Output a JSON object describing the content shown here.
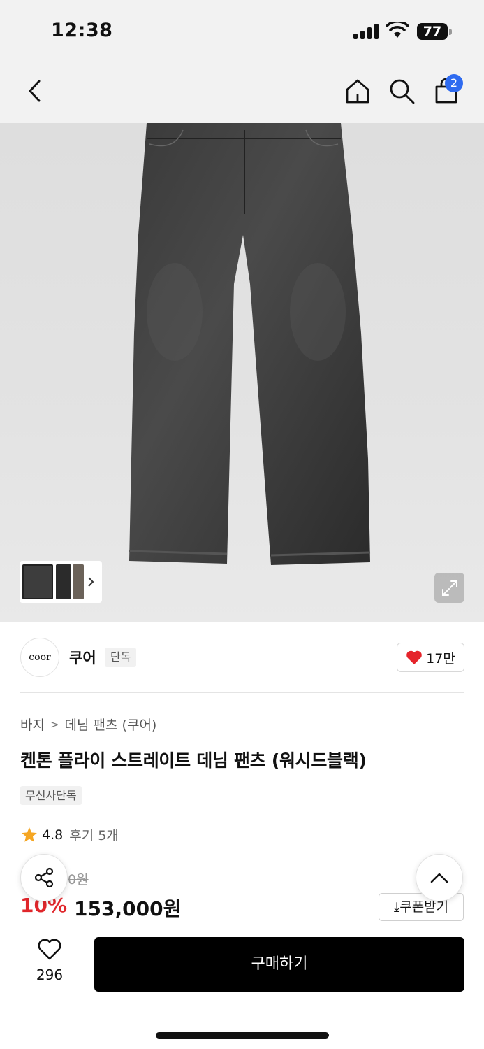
{
  "status": {
    "time": "12:38",
    "battery": "77"
  },
  "nav": {
    "cart_count": "2"
  },
  "brand": {
    "logo_text": "coor",
    "name": "쿠어",
    "tag": "단독",
    "likes": "17만"
  },
  "breadcrumb": {
    "category": "바지",
    "separator": ">",
    "subcategory": "데님 팬츠 (쿠어)"
  },
  "product": {
    "title": "켄톤 플라이 스트레이트 데님 팬츠 (워시드블랙)",
    "exclusive_tag": "무신사단독",
    "rating": "4.8",
    "review_label": "후기 5개",
    "original_price_visible": "0원",
    "discount": "10%",
    "price": "153,000원",
    "coupon_label": "⤓쿠폰받기"
  },
  "bottom": {
    "wish_count": "296",
    "buy_label": "구매하기"
  },
  "colors": {
    "accent_blue": "#2f6bf0",
    "discount_red": "#e0262b",
    "heart_red": "#e5242b",
    "star": "#f5a623"
  },
  "icons": [
    "back-icon",
    "home-icon",
    "search-icon",
    "cart-icon",
    "chevron-right-icon",
    "expand-icon",
    "heart-icon",
    "star-icon",
    "share-icon",
    "chevron-up-icon"
  ]
}
